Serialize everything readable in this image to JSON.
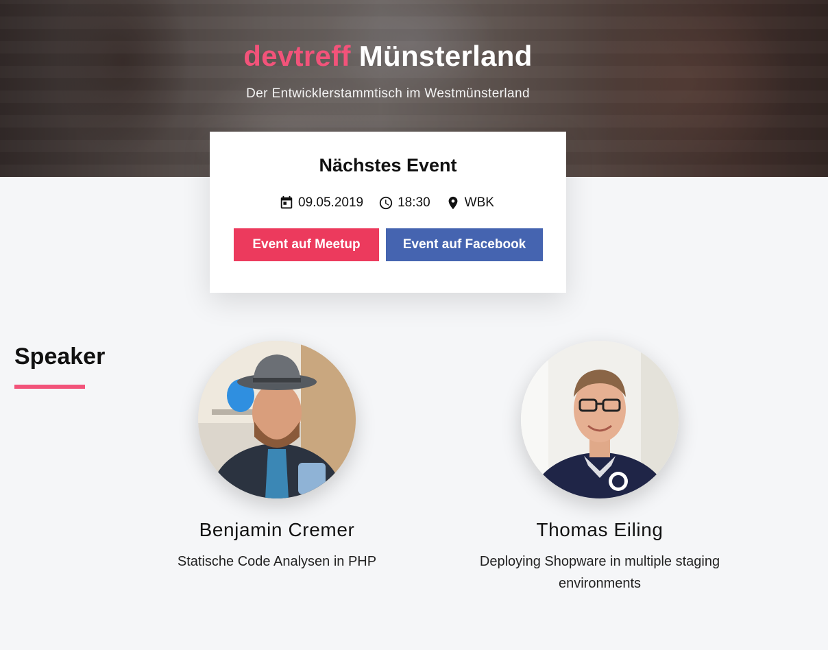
{
  "hero": {
    "title_accent": "devtreff",
    "title_rest": "Münsterland",
    "subtitle": "Der Entwicklerstammtisch im Westmünsterland"
  },
  "event": {
    "heading": "Nächstes Event",
    "date": "09.05.2019",
    "time": "18:30",
    "location": "WBK",
    "icons": [
      "calendar-icon",
      "clock-icon",
      "location-pin-icon"
    ],
    "meetup_label": "Event auf Meetup",
    "facebook_label": "Event auf Facebook"
  },
  "speakers_section": {
    "title": "Speaker",
    "speakers": [
      {
        "name": "Benjamin Cremer",
        "talk": "Statische Code Analysen in PHP"
      },
      {
        "name": "Thomas Eiling",
        "talk": "Deploying Shopware in multiple staging environments"
      }
    ]
  },
  "colors": {
    "accent": "#f2537a",
    "meetup": "#ec3a5d",
    "facebook": "#4564b0",
    "background": "#f5f6f8"
  }
}
